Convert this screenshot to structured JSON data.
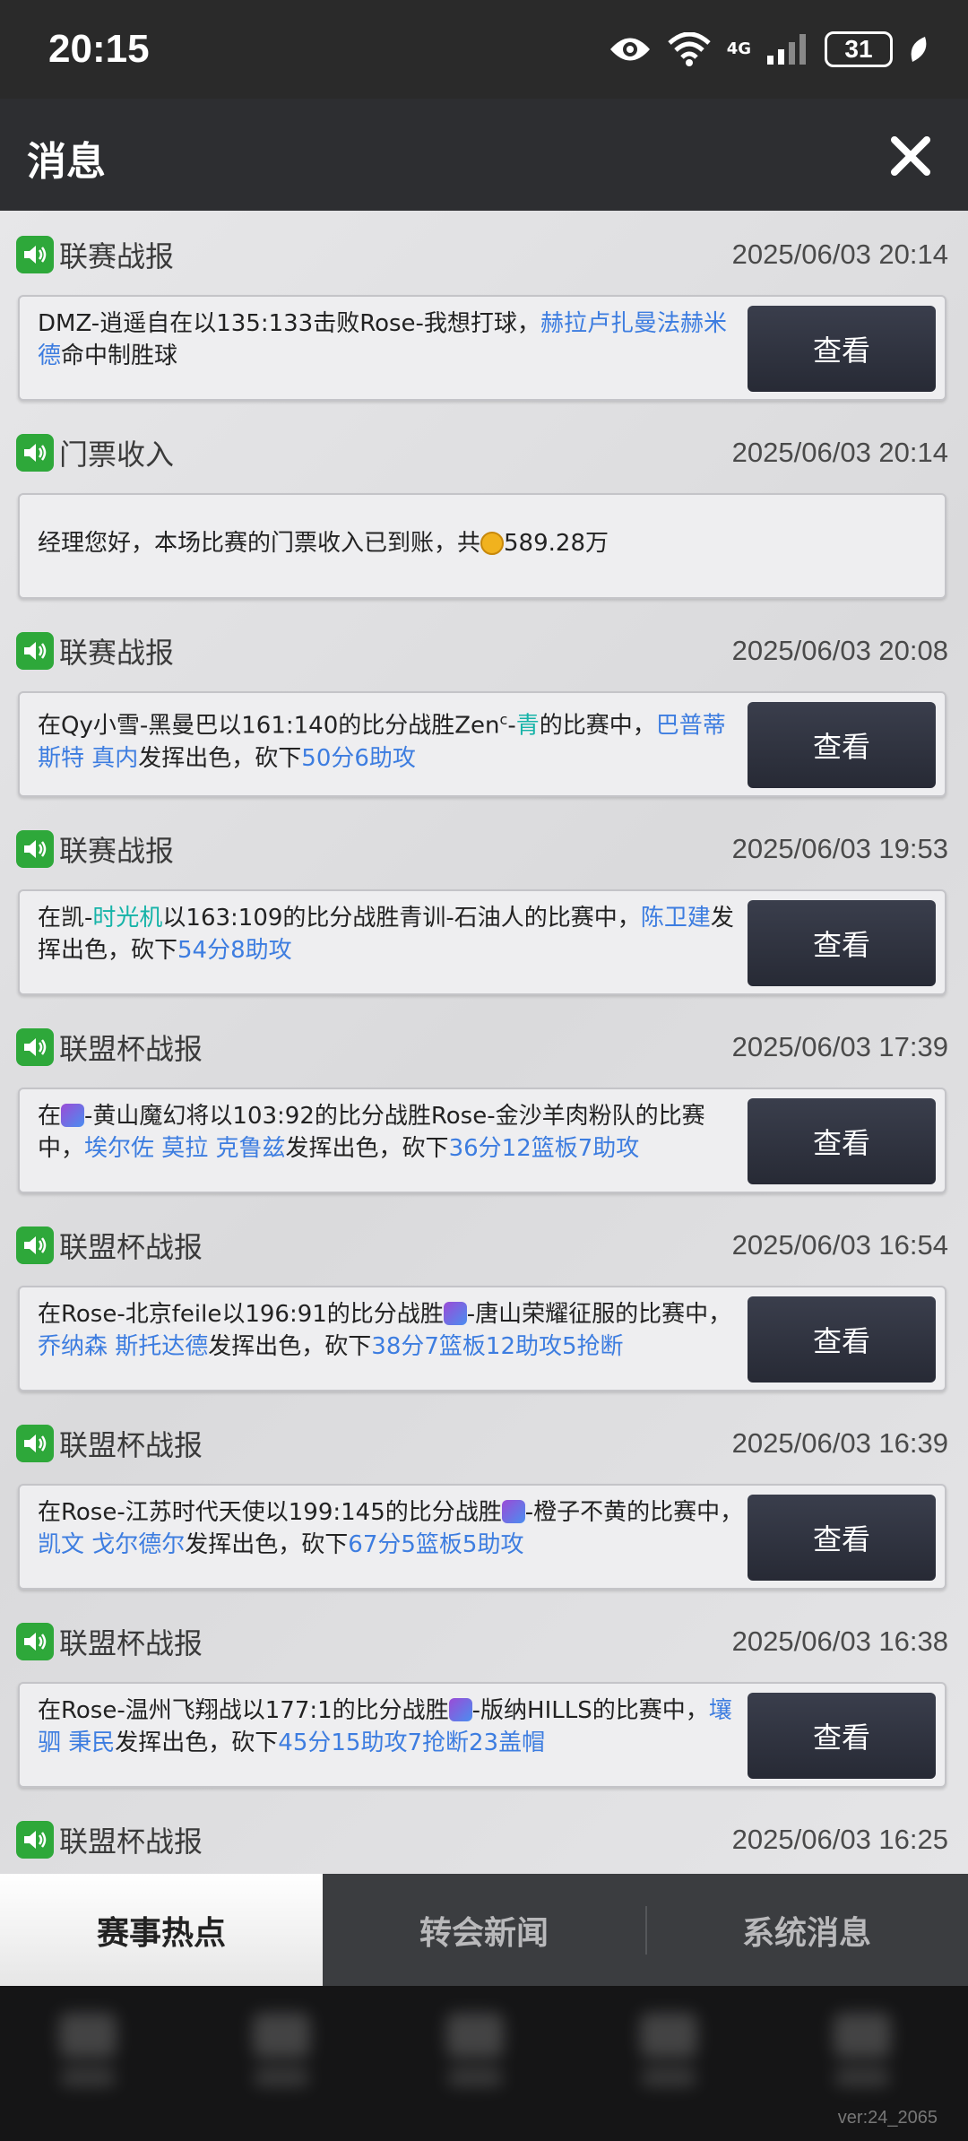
{
  "status_bar": {
    "time": "20:15",
    "network": "4G",
    "battery": "31"
  },
  "header": {
    "title": "消息"
  },
  "messages": [
    {
      "category": "联赛战报",
      "time": "2025/06/03 20:14",
      "button": "查看",
      "segments": [
        {
          "t": "DMZ-逍遥自在以135:133击败Rose-我想打球，"
        },
        {
          "t": "赫拉卢扎曼法赫米德",
          "c": "hl"
        },
        {
          "t": "命中制胜球"
        }
      ]
    },
    {
      "category": "门票收入",
      "time": "2025/06/03 20:14",
      "button": "",
      "segments": [
        {
          "t": "经理您好，本场比赛的门票收入已到账，共"
        },
        {
          "t": "",
          "c": "coin"
        },
        {
          "t": "589.28万"
        }
      ]
    },
    {
      "category": "联赛战报",
      "time": "2025/06/03 20:08",
      "button": "查看",
      "segments": [
        {
          "t": "在Qy小雪-黑曼巴以161:140的比分战胜Zen"
        },
        {
          "t": "c",
          "c": "sup"
        },
        {
          "t": "-"
        },
        {
          "t": "青",
          "c": "hlg"
        },
        {
          "t": "的比赛中，"
        },
        {
          "t": "巴普蒂斯特 真内",
          "c": "hl"
        },
        {
          "t": "发挥出色，砍下"
        },
        {
          "t": "50分6助攻",
          "c": "hl"
        }
      ]
    },
    {
      "category": "联赛战报",
      "time": "2025/06/03 19:53",
      "button": "查看",
      "segments": [
        {
          "t": "在凯-"
        },
        {
          "t": "时光机",
          "c": "hlg"
        },
        {
          "t": "以163:109的比分战胜青训-石油人的比赛中，"
        },
        {
          "t": "陈卫建",
          "c": "hl"
        },
        {
          "t": "发挥出色，砍下"
        },
        {
          "t": "54分8助攻",
          "c": "hl"
        }
      ]
    },
    {
      "category": "联盟杯战报",
      "time": "2025/06/03 17:39",
      "button": "查看",
      "segments": [
        {
          "t": "在"
        },
        {
          "t": "",
          "c": "emo"
        },
        {
          "t": "-黄山魔幻将以103:92的比分战胜Rose-金沙羊肉粉队的比赛中，"
        },
        {
          "t": "埃尔佐 莫拉 克鲁兹",
          "c": "hl"
        },
        {
          "t": "发挥出色，砍下"
        },
        {
          "t": "36分12篮板7助攻",
          "c": "hl"
        }
      ]
    },
    {
      "category": "联盟杯战报",
      "time": "2025/06/03 16:54",
      "button": "查看",
      "segments": [
        {
          "t": "在Rose-北京feile以196:91的比分战胜"
        },
        {
          "t": "",
          "c": "emo"
        },
        {
          "t": "-唐山荣耀征服的比赛中，"
        },
        {
          "t": "乔纳森 斯托达德",
          "c": "hl"
        },
        {
          "t": "发挥出色，砍下"
        },
        {
          "t": "38分7篮板12助攻5抢断",
          "c": "hl"
        }
      ]
    },
    {
      "category": "联盟杯战报",
      "time": "2025/06/03 16:39",
      "button": "查看",
      "segments": [
        {
          "t": "在Rose-江苏时代天使以199:145的比分战胜"
        },
        {
          "t": "",
          "c": "emo"
        },
        {
          "t": "-橙子不黄的比赛中，"
        },
        {
          "t": "凯文 戈尔德尔",
          "c": "hl"
        },
        {
          "t": "发挥出色，砍下"
        },
        {
          "t": "67分5篮板5助攻",
          "c": "hl"
        }
      ]
    },
    {
      "category": "联盟杯战报",
      "time": "2025/06/03 16:38",
      "button": "查看",
      "segments": [
        {
          "t": "在Rose-温州飞翔战以177:1的比分战胜"
        },
        {
          "t": "",
          "c": "emo"
        },
        {
          "t": "-版纳HILLS的比赛中，"
        },
        {
          "t": "壤驷 秉民",
          "c": "hl"
        },
        {
          "t": "发挥出色，砍下"
        },
        {
          "t": "45分15助攻7抢断23盖帽",
          "c": "hl"
        }
      ]
    },
    {
      "category": "联盟杯战报",
      "time": "2025/06/03 16:25",
      "button": "",
      "segments": []
    }
  ],
  "tabs": [
    {
      "label": "赛事热点",
      "active": true
    },
    {
      "label": "转会新闻",
      "active": false
    },
    {
      "label": "系统消息",
      "active": false
    }
  ],
  "version": "ver:24_2065"
}
